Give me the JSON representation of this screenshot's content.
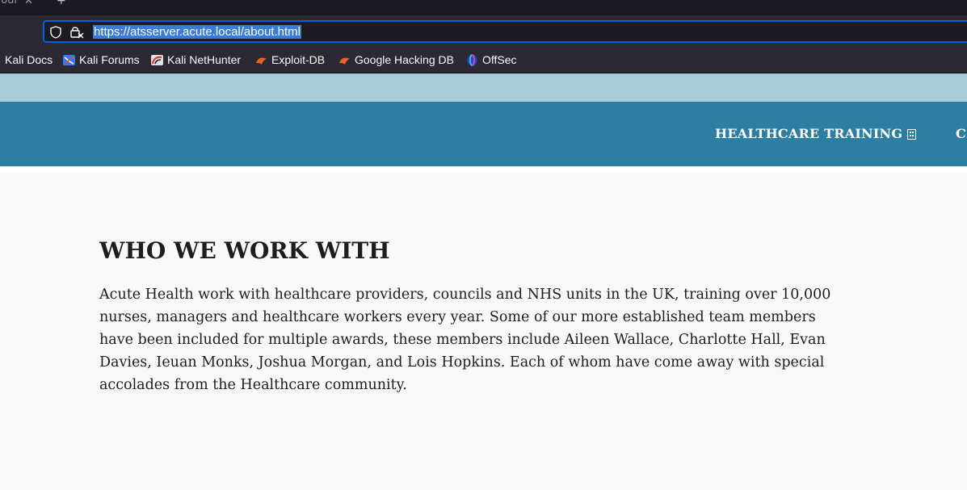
{
  "browser": {
    "tab_fragment": "‹our",
    "tab_close_glyph": "✕",
    "new_tab_glyph": "+",
    "url": "https://atsserver.acute.local/about.html",
    "icons": {
      "shield": "tracking-protection-shield-icon",
      "lock": "insecure-lock-icon"
    }
  },
  "bookmarks": [
    {
      "label": "Kali Docs",
      "icon": "kali-icon"
    },
    {
      "label": "Kali Forums",
      "icon": "kali-forums-icon"
    },
    {
      "label": "Kali NetHunter",
      "icon": "nethunter-icon"
    },
    {
      "label": "Exploit-DB",
      "icon": "exploit-db-icon"
    },
    {
      "label": "Google Hacking DB",
      "icon": "ghdb-icon"
    },
    {
      "label": "OffSec",
      "icon": "offsec-icon"
    }
  ],
  "site": {
    "nav": {
      "item_healthcare": "HEALTHCARE TRAINING",
      "item_partial": "C"
    },
    "section": {
      "heading": "WHO WE WORK WITH",
      "body": "Acute Health work with healthcare providers, councils and NHS units in the UK, training over 10,000 nurses, managers and healthcare workers every year. Some of our more established team members have been included for multiple awards, these members include Aileen Wallace, Charlotte Hall, Evan Davies, Ieuan Monks, Joshua Morgan, and Lois Hopkins. Each of whom have come away with special accolades from the Healthcare community."
    }
  },
  "colors": {
    "browser_chrome": "#2b2a33",
    "url_focus_border": "#0060df",
    "url_selection": "#3a7bd5",
    "site_top_band": "#a9cbd8",
    "site_nav": "#2c7ea3",
    "page_bg": "#f8f8f8"
  }
}
